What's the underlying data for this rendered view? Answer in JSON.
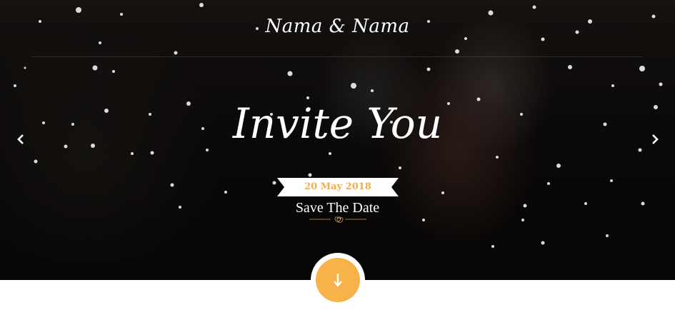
{
  "header": {
    "brand": "Nama & Nama"
  },
  "hero": {
    "headline": "Invite You",
    "date": "20 May 2018",
    "caption": "Save The Date",
    "prev_icon": "chevron-left-icon",
    "next_icon": "chevron-right-icon",
    "divider_icon": "hearts-icon"
  },
  "scroll": {
    "icon": "arrow-down-icon"
  },
  "colors": {
    "accent": "#f7b24a",
    "date_text": "#f0ad4e",
    "hero_bg": "#0d0b0a",
    "text": "#ffffff"
  }
}
